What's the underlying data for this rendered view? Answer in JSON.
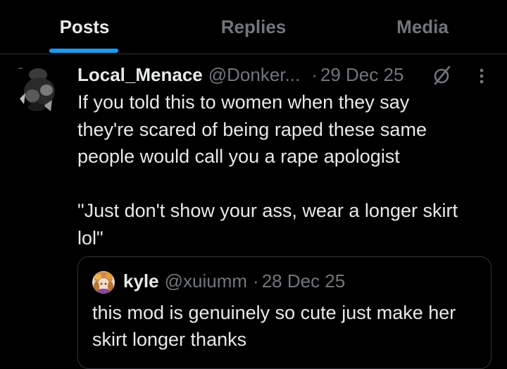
{
  "tabs": [
    {
      "label": "Posts",
      "active": true
    },
    {
      "label": "Replies",
      "active": false
    },
    {
      "label": "Media",
      "active": false
    }
  ],
  "post": {
    "display_name": "Local_Menace",
    "handle": "@Donker...",
    "separator": "·",
    "date": "29 Dec 25",
    "body_lines": [
      "If you told this to women when they say",
      "they're scared of being raped these same",
      "people would call you a rape apologist",
      "",
      "\"Just don't show your ass, wear a longer skirt",
      "lol\""
    ]
  },
  "quoted_post": {
    "display_name": "kyle",
    "handle": "@xuiumm",
    "separator": "·",
    "date": "28 Dec 25",
    "body_lines": [
      "this mod is genuinely so cute just make her",
      "skirt longer thanks"
    ]
  },
  "icons": {
    "grok": "grok-slash-circle-icon",
    "more": "more-vertical-icon"
  },
  "colors": {
    "background": "#000000",
    "text": "#e7e9ea",
    "secondary_text": "#71767b",
    "accent": "#1d9bf0",
    "border": "#2f3336"
  }
}
